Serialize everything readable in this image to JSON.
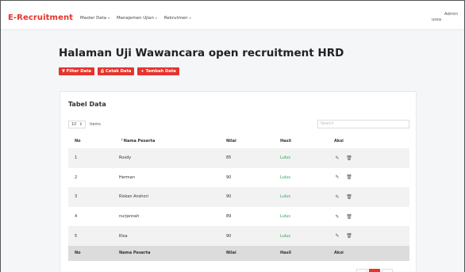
{
  "nav": {
    "brand": "E-Recruitment",
    "menu": [
      {
        "label": "Master Data"
      },
      {
        "label": "Manajemen Ujian"
      },
      {
        "label": "Rekrutmen"
      }
    ],
    "user_name": "Admin",
    "user_sub": "ussa"
  },
  "page": {
    "title": "Halaman Uji Wawancara open recruitment HRD"
  },
  "toolbar": {
    "filter_label": "Filter Data",
    "cetak_label": "Cetak Data",
    "tambah_label": "Tambah Data"
  },
  "table": {
    "card_title": "Tabel Data",
    "length_value": "10",
    "length_suffix": "items",
    "search_placeholder": "Search",
    "columns": [
      "No",
      "Nama Peserta",
      "Nilai",
      "Hasil",
      "Aksi"
    ],
    "rows": [
      {
        "no": "1",
        "nama": "Rusdy",
        "nilai": "85",
        "hasil": "Lulus"
      },
      {
        "no": "2",
        "nama": "Herman",
        "nilai": "90",
        "hasil": "Lulus"
      },
      {
        "no": "3",
        "nama": "Riskan Anshori",
        "nilai": "90",
        "hasil": "Lulus"
      },
      {
        "no": "4",
        "nama": "nurjannah",
        "nilai": "89",
        "hasil": "Lulus"
      },
      {
        "no": "5",
        "nama": "Risa",
        "nilai": "90",
        "hasil": "Lulus"
      }
    ],
    "footer_columns": [
      "No",
      "Nama Peserta",
      "Nilai",
      "Hasil",
      "Aksi"
    ]
  },
  "colors": {
    "accent": "#e7332c",
    "success": "#2aa55a"
  },
  "icons": {
    "edit": "edit-icon",
    "delete": "trash-icon",
    "sort": "sort-icon"
  }
}
